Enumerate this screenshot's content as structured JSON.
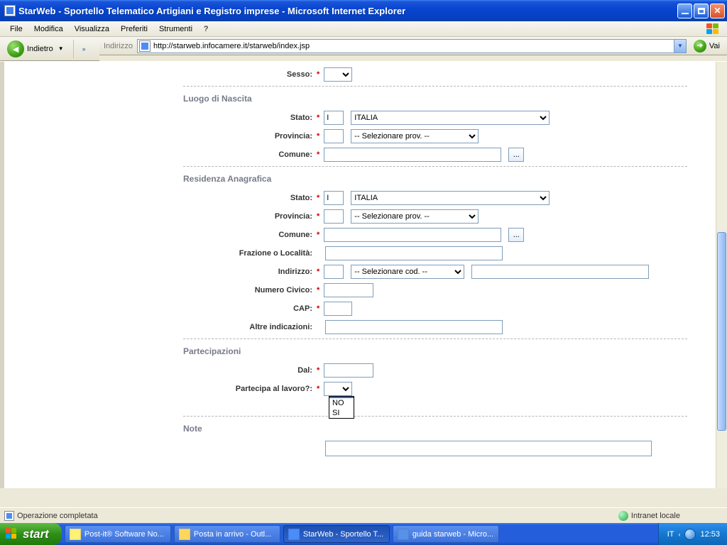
{
  "window": {
    "title": "StarWeb - Sportello Telematico Artigiani e Registro imprese - Microsoft Internet Explorer"
  },
  "menubar": [
    "File",
    "Modifica",
    "Visualizza",
    "Preferiti",
    "Strumenti",
    "?"
  ],
  "navbar": {
    "back": "Indietro"
  },
  "addressbar": {
    "label": "Indirizzo",
    "url": "http://starweb.infocamere.it/starweb/index.jsp",
    "go": "Vai"
  },
  "form": {
    "sesso_label": "Sesso:",
    "luogo_title": "Luogo di Nascita",
    "stato_label": "Stato:",
    "stato_code": "I",
    "stato_name": "ITALIA",
    "provincia_label": "Provincia:",
    "provincia_placeholder": "-- Selezionare prov. --",
    "comune_label": "Comune:",
    "ellipsis": "...",
    "residenza_title": "Residenza Anagrafica",
    "fraz_label": "Frazione o Località:",
    "indirizzo_label": "Indirizzo:",
    "indirizzo_placeholder": "-- Selezionare cod. --",
    "civico_label": "Numero Civico:",
    "cap_label": "CAP:",
    "altre_label": "Altre indicazioni:",
    "part_title": "Partecipazioni",
    "dal_label": "Dal:",
    "partecipa_label": "Partecipa al lavoro?:",
    "opt_empty": "",
    "opt_no": "NO",
    "opt_si": "SI",
    "note_title": "Note"
  },
  "status": {
    "done": "Operazione completata",
    "zone": "Intranet locale"
  },
  "taskbar": {
    "start": "start",
    "items": [
      "Post-it® Software No...",
      "Posta in arrivo - Outl...",
      "StarWeb - Sportello T...",
      "guida starweb - Micro..."
    ],
    "lang": "IT",
    "clock": "12:53"
  }
}
